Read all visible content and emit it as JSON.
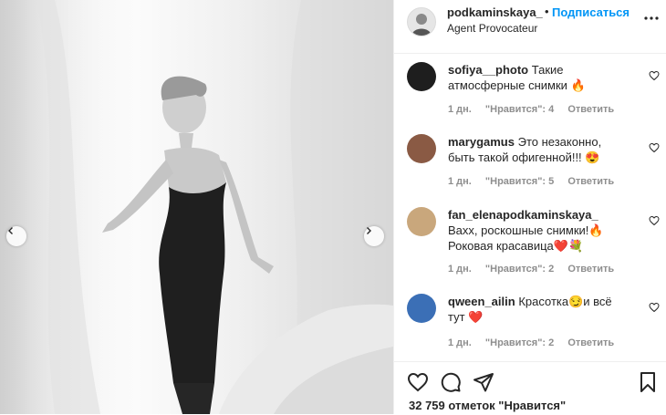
{
  "post": {
    "username": "podkaminskaya_",
    "separator": "•",
    "follow_label": "Подписаться",
    "location": "Agent Provocateur"
  },
  "comments": [
    {
      "username": "sofiya__photo",
      "text": "Такие атмосферные снимки 🔥",
      "age": "1 дн.",
      "likes": "\"Нравится\": 4",
      "reply": "Ответить",
      "avatar_color": "#1e1e1e"
    },
    {
      "username": "marygamus",
      "text": "Это незаконно, быть такой офигенной!!! 😍",
      "age": "1 дн.",
      "likes": "\"Нравится\": 5",
      "reply": "Ответить",
      "avatar_color": "#8a5a44"
    },
    {
      "username": "fan_elenapodkaminskaya_",
      "text": "Вахх, роскошные снимки!🔥Роковая красавица❤️💐",
      "age": "1 дн.",
      "likes": "\"Нравится\": 2",
      "reply": "Ответить",
      "avatar_color": "#c9a77c"
    },
    {
      "username": "qween_ailin",
      "text": "Красотка😏и всё тут ❤️",
      "age": "1 дн.",
      "likes": "\"Нравится\": 2",
      "reply": "Ответить",
      "avatar_color": "#3b6fb6"
    }
  ],
  "footer": {
    "likes_text": "32 759 отметок \"Нравится\""
  },
  "icons": {
    "like": "heart-icon",
    "comment": "comment-icon",
    "share": "send-icon",
    "save": "bookmark-icon",
    "more": "more-icon",
    "prev": "chevron-left-icon",
    "next": "chevron-right-icon"
  },
  "colors": {
    "accent": "#0095f6",
    "meta": "#8e8e8e",
    "text": "#262626"
  }
}
